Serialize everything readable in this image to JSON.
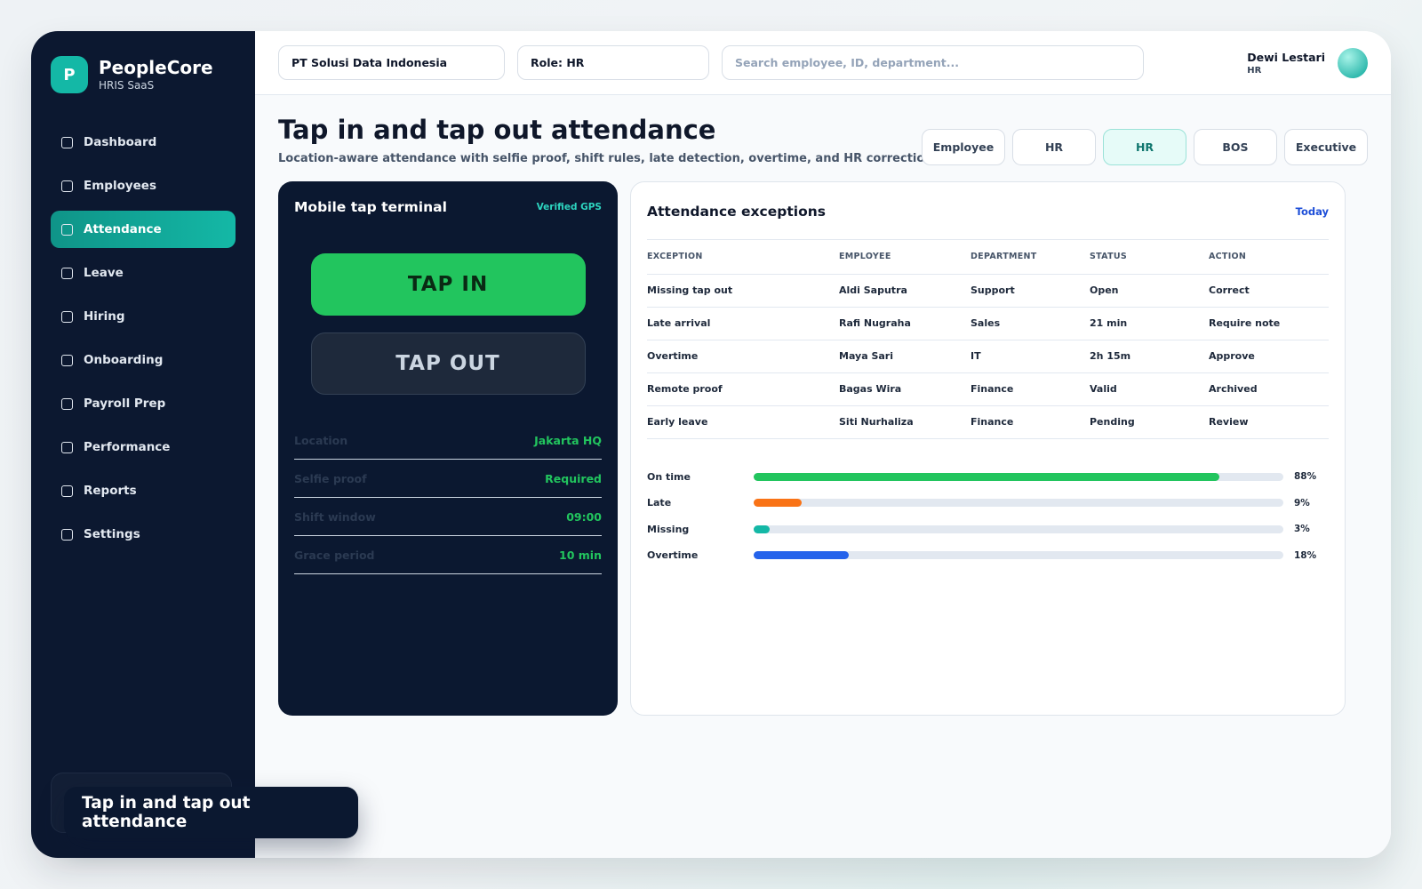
{
  "brand": {
    "logo_letter": "P",
    "name": "PeopleCore",
    "subtitle": "HRIS SaaS"
  },
  "sidebar": {
    "items": [
      {
        "label": "Dashboard",
        "active": false
      },
      {
        "label": "Employees",
        "active": false
      },
      {
        "label": "Attendance",
        "active": true
      },
      {
        "label": "Leave",
        "active": false
      },
      {
        "label": "Hiring",
        "active": false
      },
      {
        "label": "Onboarding",
        "active": false
      },
      {
        "label": "Payroll Prep",
        "active": false
      },
      {
        "label": "Performance",
        "active": false
      },
      {
        "label": "Reports",
        "active": false
      },
      {
        "label": "Settings",
        "active": false
      }
    ]
  },
  "topbar": {
    "company": "PT Solusi Data Indonesia",
    "role": "Role: HR",
    "search_placeholder": "Search employee, ID, department...",
    "user_name": "Dewi Lestari",
    "user_role": "HR"
  },
  "page": {
    "title": "Tap in and tap out attendance",
    "subtitle": "Location-aware attendance with selfie proof, shift rules, late detection, overtime, and HR correction flow."
  },
  "role_tabs": [
    {
      "label": "Employee",
      "active": false
    },
    {
      "label": "HR",
      "active": false
    },
    {
      "label": "HR",
      "active": true
    },
    {
      "label": "BOS",
      "active": false
    },
    {
      "label": "Executive",
      "active": false
    }
  ],
  "terminal": {
    "title": "Mobile tap terminal",
    "badge": "Verified GPS",
    "tap_in_label": "TAP IN",
    "tap_out_label": "TAP OUT",
    "info": [
      {
        "label": "Location",
        "value": "Jakarta HQ"
      },
      {
        "label": "Selfie proof",
        "value": "Required"
      },
      {
        "label": "Shift window",
        "value": "09:00"
      },
      {
        "label": "Grace period",
        "value": "10 min"
      }
    ]
  },
  "exceptions": {
    "title": "Attendance exceptions",
    "link": "Today",
    "columns": [
      "EXCEPTION",
      "EMPLOYEE",
      "DEPARTMENT",
      "STATUS",
      "ACTION"
    ],
    "rows": [
      [
        "Missing tap out",
        "Aldi Saputra",
        "Support",
        "Open",
        "Correct"
      ],
      [
        "Late arrival",
        "Rafi Nugraha",
        "Sales",
        "21 min",
        "Require note"
      ],
      [
        "Overtime",
        "Maya Sari",
        "IT",
        "2h 15m",
        "Approve"
      ],
      [
        "Remote proof",
        "Bagas Wira",
        "Finance",
        "Valid",
        "Archived"
      ],
      [
        "Early leave",
        "Siti Nurhaliza",
        "Finance",
        "Pending",
        "Review"
      ]
    ],
    "stats": [
      {
        "label": "On time",
        "percent": 88,
        "display": "88%",
        "color": "#22c55e"
      },
      {
        "label": "Late",
        "percent": 9,
        "display": "9%",
        "color": "#f97316"
      },
      {
        "label": "Missing",
        "percent": 3,
        "display": "3%",
        "color": "#14b8a6"
      },
      {
        "label": "Overtime",
        "percent": 18,
        "display": "18%",
        "color": "#2563eb"
      }
    ]
  },
  "toast": {
    "text": "Tap in and tap out attendance"
  }
}
